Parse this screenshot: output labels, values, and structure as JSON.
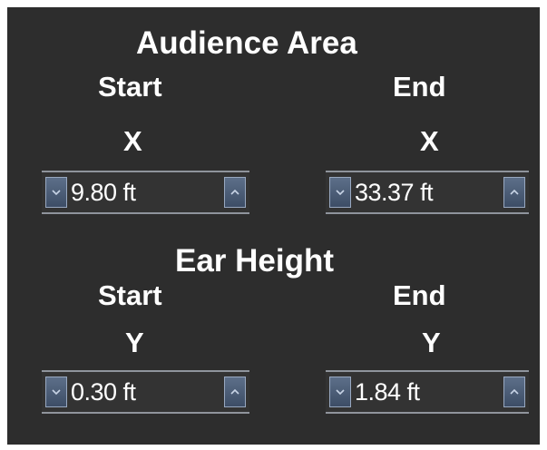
{
  "audience_area": {
    "title": "Audience Area",
    "start": {
      "label": "Start",
      "axis": "X",
      "value": "9.80 ft"
    },
    "end": {
      "label": "End",
      "axis": "X",
      "value": "33.37 ft"
    }
  },
  "ear_height": {
    "title": "Ear Height",
    "start": {
      "label": "Start",
      "axis": "Y",
      "value": "0.30 ft"
    },
    "end": {
      "label": "End",
      "axis": "Y",
      "value": "1.84 ft"
    }
  },
  "icons": {
    "decrement": "chevron-down-icon",
    "increment": "chevron-up-icon"
  },
  "colors": {
    "panel_background": "#2d2d2d",
    "text": "#ffffff",
    "spinner_button": "#4d5e78",
    "spinner_border": "#8f949c"
  }
}
